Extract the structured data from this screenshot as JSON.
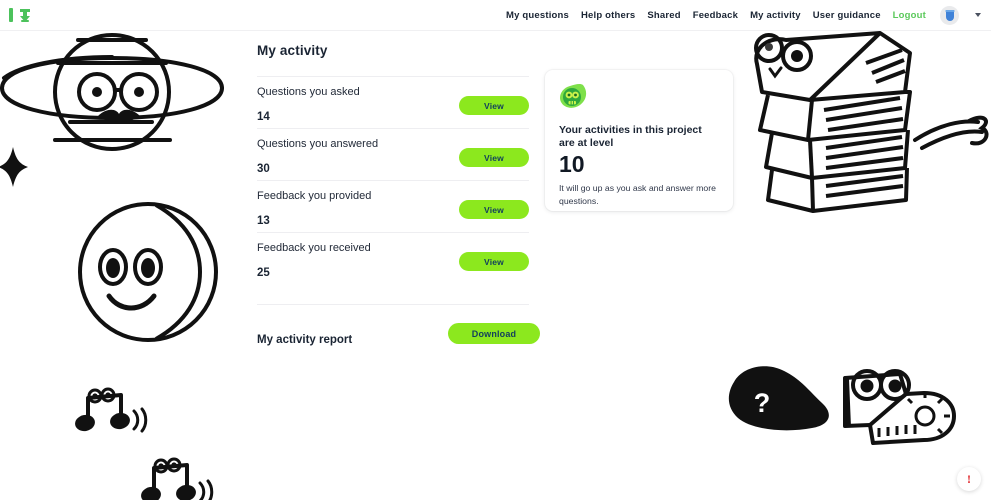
{
  "header": {
    "logo_name": "app-logo",
    "nav": [
      {
        "label": "My questions",
        "name": "nav-my-questions"
      },
      {
        "label": "Help others",
        "name": "nav-help-others"
      },
      {
        "label": "Shared",
        "name": "nav-shared"
      },
      {
        "label": "Feedback",
        "name": "nav-feedback"
      },
      {
        "label": "My activity",
        "name": "nav-my-activity"
      },
      {
        "label": "User guidance",
        "name": "nav-user-guidance"
      }
    ],
    "logout_label": "Logout",
    "avatar_icon": "user-avatar-icon",
    "caret_icon": "chevron-down-icon"
  },
  "main": {
    "title": "My activity",
    "rows": [
      {
        "label": "Questions you asked",
        "value": "14",
        "button": "View"
      },
      {
        "label": "Questions you answered",
        "value": "30",
        "button": "View"
      },
      {
        "label": "Feedback you provided",
        "value": "13",
        "button": "View"
      },
      {
        "label": "Feedback you received",
        "value": "25",
        "button": "View"
      }
    ],
    "report": {
      "label": "My activity report",
      "button": "Download"
    }
  },
  "level_card": {
    "badge_icon": "level-badge-icon",
    "heading": "Your activities in this project are at level",
    "level": "10",
    "note": "It will go up as you ask and answer more questions."
  },
  "help_fab": {
    "icon": "exclamation-icon",
    "glyph": "!"
  },
  "colors": {
    "accent_green": "#8ce81e",
    "logout_green": "#5bc95b",
    "button_text": "#13415c",
    "text_dark": "#1a2433",
    "alert_red": "#e0272b"
  }
}
